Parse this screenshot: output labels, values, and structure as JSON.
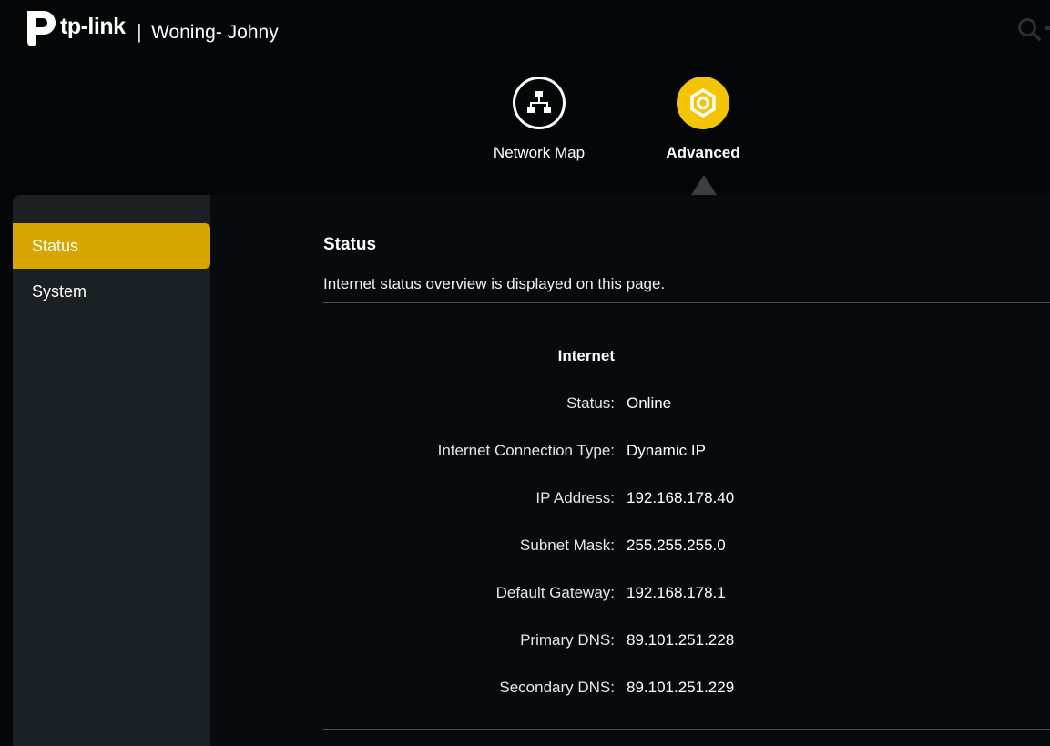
{
  "header": {
    "brand": "tp-link",
    "separator": "|",
    "device_name": "Woning- Johny",
    "search_icon": "search-icon"
  },
  "nav": {
    "tabs": [
      {
        "label": "Network Map",
        "icon": "network-map-icon",
        "active": false
      },
      {
        "label": "Advanced",
        "icon": "gear-icon",
        "active": true
      }
    ]
  },
  "sidebar": {
    "items": [
      {
        "label": "Status",
        "active": true
      },
      {
        "label": "System",
        "active": false
      }
    ]
  },
  "content": {
    "title": "Status",
    "description": "Internet status overview is displayed on this page.",
    "section_title": "Internet",
    "rows": [
      {
        "label": "Status:",
        "value": "Online"
      },
      {
        "label": "Internet Connection Type:",
        "value": "Dynamic IP"
      },
      {
        "label": "IP Address:",
        "value": "192.168.178.40"
      },
      {
        "label": "Subnet Mask:",
        "value": "255.255.255.0"
      },
      {
        "label": "Default Gateway:",
        "value": "192.168.178.1"
      },
      {
        "label": "Primary DNS:",
        "value": "89.101.251.228"
      },
      {
        "label": "Secondary DNS:",
        "value": "89.101.251.229"
      }
    ]
  },
  "colors": {
    "accent": "#f5c400",
    "sidebar_active": "#d7a600",
    "background": "#040608",
    "sidebar_bg": "#1b2024"
  }
}
